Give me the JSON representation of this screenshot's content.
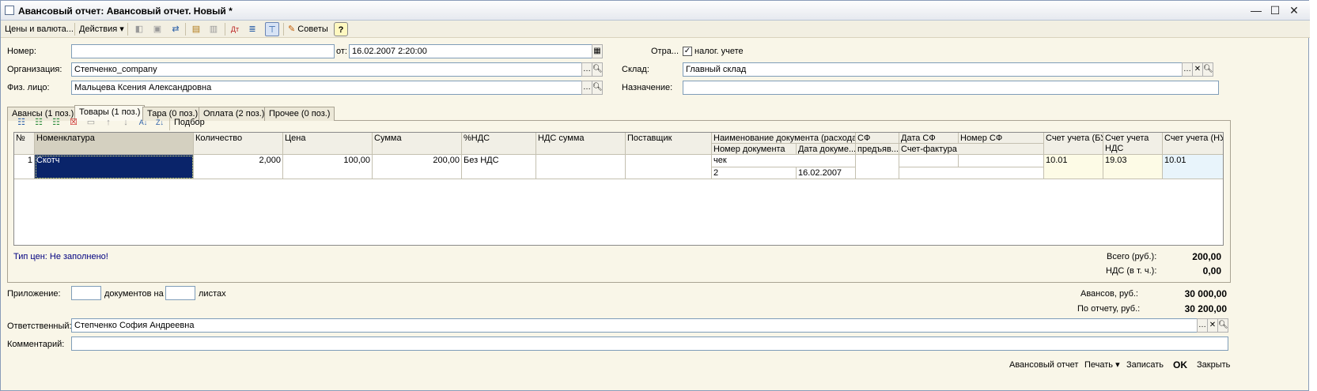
{
  "window": {
    "title": "Авансовый отчет: Авансовый отчет. Новый *",
    "min": "—",
    "max": "☐",
    "close": "✕"
  },
  "toolbar": {
    "prices": "Цены и валюта...",
    "actions": "Действия",
    "tips": "Советы",
    "help": "?"
  },
  "form": {
    "number_label": "Номер:",
    "number_value": "",
    "date_label": "от:",
    "date_value": "16.02.2007  2:20:00",
    "reflect_label": "Отра...",
    "tax_label": "налог. учете",
    "tax_checked": "✓",
    "org_label": "Организация:",
    "org_value": "Степченко_company",
    "warehouse_label": "Склад:",
    "warehouse_value": "Главный склад",
    "person_label": "Физ. лицо:",
    "person_value": "Мальцева Ксения Александровна",
    "purpose_label": "Назначение:",
    "purpose_value": ""
  },
  "tabs": [
    "Авансы (1 поз.)",
    "Товары (1 поз.)",
    "Тара (0 поз.)",
    "Оплата (2 поз.)",
    "Прочее (0 поз.)"
  ],
  "grid_toolbar": {
    "pick": "Подбор"
  },
  "grid": {
    "headers": {
      "no": "№",
      "nomen": "Номенклатура",
      "qty": "Количество",
      "price": "Цена",
      "sum": "Сумма",
      "vat_pct": "%НДС",
      "vat_sum": "НДС сумма",
      "supplier": "Поставщик",
      "doc_name": "Наименование документа (расхода)",
      "doc_no": "Номер документа",
      "doc_date": "Дата докуме...",
      "sf": "СФ",
      "sf2": "предъяв...",
      "sf_date": "Дата СФ",
      "sf_no": "Номер СФ",
      "invoice": "Счет-фактура",
      "acc_bu": "Счет учета (БУ)",
      "acc_vat": "Счет учета",
      "acc_vat2": "НДС",
      "acc_nu": "Счет учета (НУ)"
    },
    "row": {
      "no": "1",
      "nomen": "Скотч",
      "qty": "2,000",
      "price": "100,00",
      "sum": "200,00",
      "vat_pct": "Без НДС",
      "vat_sum": "",
      "supplier": "",
      "doc_name": "чек",
      "doc_no": "2",
      "doc_date": "16.02.2007",
      "acc_bu": "10.01",
      "acc_vat": "19.03",
      "acc_nu": "10.01"
    }
  },
  "summary": {
    "price_type": "Тип цен: Не заполнено!",
    "total_label": "Всего (руб.):",
    "total_value": "200,00",
    "vat_label": "НДС (в т. ч.):",
    "vat_value": "0,00"
  },
  "attach": {
    "label": "Приложение:",
    "docs_label": "документов на",
    "sheets_label": "листах"
  },
  "advances": {
    "label": "Авансов, руб.:",
    "value": "30 000,00",
    "report_label": "По отчету, руб.:",
    "report_value": "30 200,00"
  },
  "responsible": {
    "label": "Ответственный:",
    "value": "Степченко София Андреевна"
  },
  "comment": {
    "label": "Комментарий:",
    "value": ""
  },
  "bottom": {
    "report": "Авансовый отчет",
    "print": "Печать",
    "save": "Записать",
    "ok": "OK",
    "close": "Закрыть"
  },
  "colors": {
    "selection": "#0a246a",
    "accent": "#e8f4fb",
    "warn": "#000080"
  }
}
